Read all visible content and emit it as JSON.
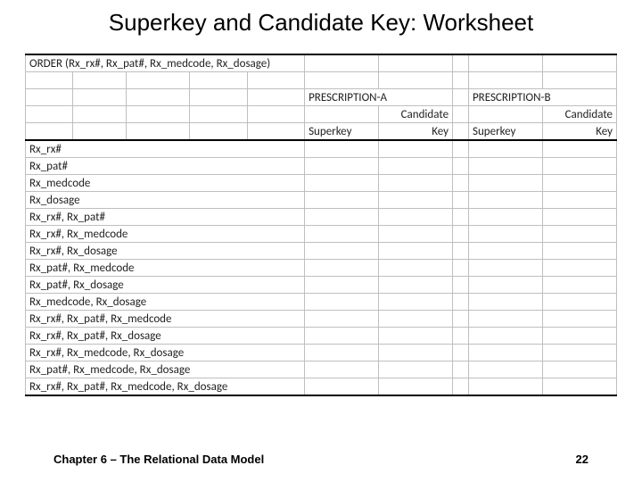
{
  "title": "Superkey and Candidate Key: Worksheet",
  "order_label": "ORDER (Rx_rx#, Rx_pat#, Rx_medcode, Rx_dosage)",
  "hdr": {
    "presA": "PRESCRIPTION-A",
    "presB": "PRESCRIPTION-B",
    "superkey": "Superkey",
    "candkey_top": "Candidate",
    "candkey_bot": "Key"
  },
  "rows": [
    "Rx_rx#",
    "Rx_pat#",
    "Rx_medcode",
    "Rx_dosage",
    "Rx_rx#, Rx_pat#",
    "Rx_rx#, Rx_medcode",
    "Rx_rx#, Rx_dosage",
    "Rx_pat#, Rx_medcode",
    "Rx_pat#, Rx_dosage",
    "Rx_medcode, Rx_dosage",
    "Rx_rx#, Rx_pat#, Rx_medcode",
    "Rx_rx#, Rx_pat#, Rx_dosage",
    "Rx_rx#, Rx_medcode, Rx_dosage",
    "Rx_pat#, Rx_medcode, Rx_dosage",
    "Rx_rx#, Rx_pat#, Rx_medcode, Rx_dosage"
  ],
  "footer": {
    "left": "Chapter 6 – The Relational Data Model",
    "right": "22"
  }
}
